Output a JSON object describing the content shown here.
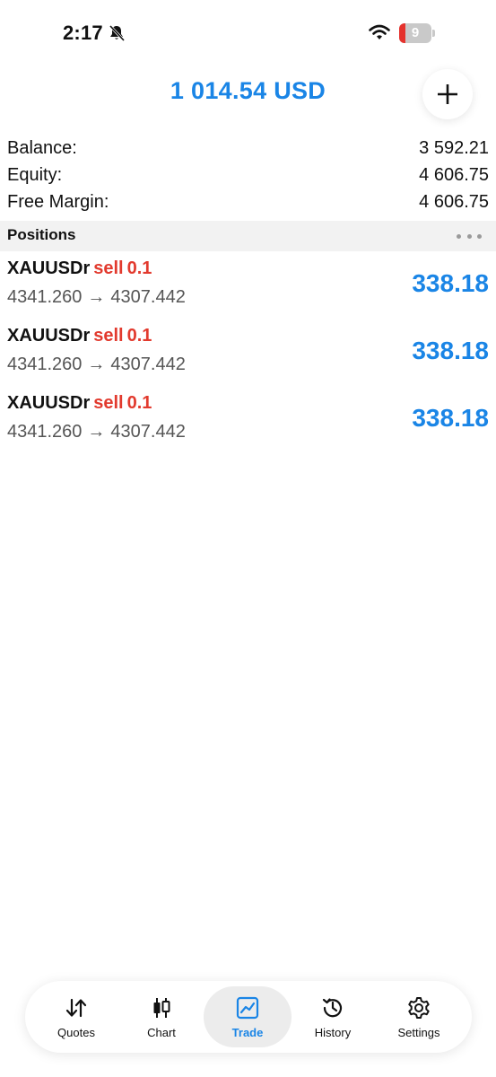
{
  "status_bar": {
    "time": "2:17",
    "battery_level": "9",
    "battery_color": "#e5322d"
  },
  "header": {
    "amount": "1 014.54 USD"
  },
  "account": {
    "balance_label": "Balance:",
    "balance_value": "3 592.21",
    "equity_label": "Equity:",
    "equity_value": "4 606.75",
    "free_margin_label": "Free Margin:",
    "free_margin_value": "4 606.75"
  },
  "positions": {
    "title": "Positions",
    "items": [
      {
        "symbol": "XAUUSDr",
        "side": "sell",
        "lot": "0.1",
        "open_price": "4341.260",
        "arrow": "→",
        "current_price": "4307.442",
        "profit": "338.18"
      },
      {
        "symbol": "XAUUSDr",
        "side": "sell",
        "lot": "0.1",
        "open_price": "4341.260",
        "arrow": "→",
        "current_price": "4307.442",
        "profit": "338.18"
      },
      {
        "symbol": "XAUUSDr",
        "side": "sell",
        "lot": "0.1",
        "open_price": "4341.260",
        "arrow": "→",
        "current_price": "4307.442",
        "profit": "338.18"
      }
    ]
  },
  "tabs": [
    {
      "label": "Quotes",
      "icon": "quotes-icon",
      "active": false
    },
    {
      "label": "Chart",
      "icon": "chart-icon",
      "active": false
    },
    {
      "label": "Trade",
      "icon": "trade-icon",
      "active": true
    },
    {
      "label": "History",
      "icon": "history-icon",
      "active": false
    },
    {
      "label": "Settings",
      "icon": "settings-icon",
      "active": false
    }
  ],
  "colors": {
    "accent": "#1a85e6",
    "sell": "#e23a2e",
    "section_bg": "#f2f2f2"
  }
}
